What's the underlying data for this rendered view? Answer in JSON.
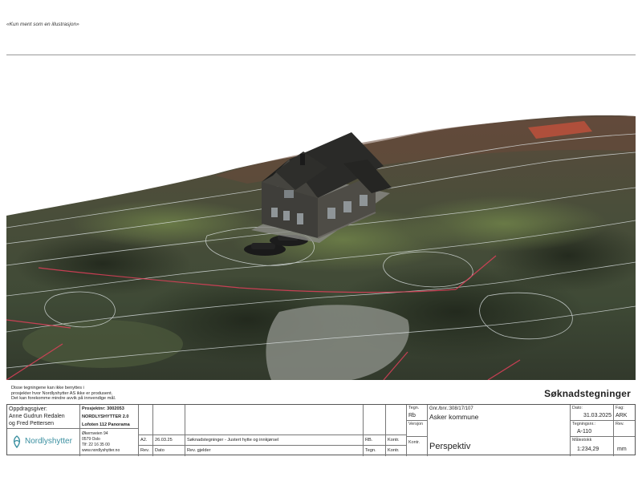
{
  "top_note": "«Kun ment som en illustrasjon»",
  "disclaimer": [
    "Disse tegningene kan ikke benyttes i",
    "prosjekter hvor Nordlyshytter AS ikke er produsent.",
    "Det kan forekomme mindre avvik på innvendige mål."
  ],
  "document_type": "Søknadstegninger",
  "client": {
    "label": "Oppdragsgiver:",
    "name_line1": "Anne Gudrun Redalen",
    "name_line2": "og Fred Pettersen"
  },
  "project": {
    "number_label": "Prosjektnr: 3002053",
    "series": "NORDLYSHYTTER 2.0",
    "model": "Lofoten 112 Panorama"
  },
  "company": {
    "name": "Nordlyshytter",
    "address": "Økernveien 94",
    "postal": "0579 Oslo",
    "phone": "Tlf: 22 16 35 00",
    "web": "www.nordlyshytter.no"
  },
  "revision": {
    "rev": "A2.",
    "date": "26.03.25",
    "description": "Søknadstegninger - Justert hytte og innkjørsel",
    "drawn_by": "RB.",
    "checked_label": "Kontr.",
    "header_rev": "Rev.",
    "header_date": "Dato",
    "header_desc": "Rev. gjelder",
    "header_drawn": "Tegn.",
    "header_checked": "Kontr."
  },
  "drawing": {
    "drawn_label": "Tegn.",
    "drawn_value": "Rb",
    "version_label": "Versjon",
    "checked_label": "Kontr.",
    "property": "Gnr./bnr.:308/17/107",
    "municipality": "Asker kommune",
    "title": "Perspektiv",
    "date_label": "Dato:",
    "date": "31.03.2025",
    "subject_label": "Fag:",
    "subject": "ARK",
    "drawing_no_label": "Tegningsnr.:",
    "drawing_no": "A-110",
    "rev_label": "Rev.",
    "scale_label": "Målestokk",
    "scale": "1:234,29",
    "unit": "mm"
  },
  "colors": {
    "logo": "#3a8fa0",
    "property_line": "#e0405a",
    "contour": "#e8eef0"
  }
}
